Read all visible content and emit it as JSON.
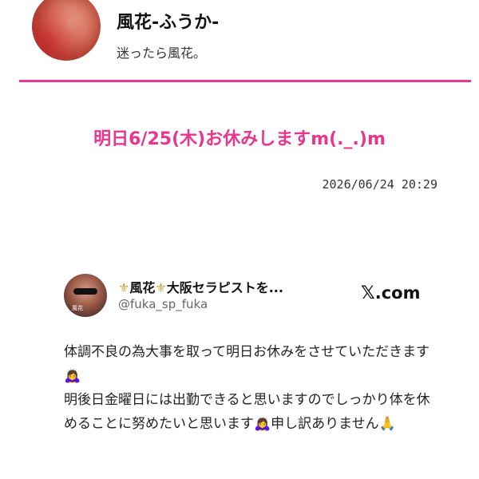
{
  "profile": {
    "name": "風花-ふうか-",
    "tagline": "迷ったら風花。"
  },
  "post": {
    "title": "明日6/25(木)お休みしますm(._.)m",
    "datetime": "2026/06/24 20:29"
  },
  "embed": {
    "fleur": "⚜",
    "display_name": "風花",
    "display_name_suffix": "大阪セラピストを...",
    "handle": "@fuka_sp_fuka",
    "avatar_tag": "風花",
    "brand_logo": "𝕏",
    "brand_text": ".com",
    "body": {
      "line1": "体調不良の為大事を取って明日お休みをさせていただきます",
      "line1_emoji": "🙇‍♀️",
      "line2": "明後日金曜日には出勤できると思いますのでしっかり体を休めることに努めたいと思います",
      "line2_emoji": "🙇‍♀️",
      "line3": "申し訳ありません",
      "line3_emoji": "🙏"
    }
  },
  "colors": {
    "accent": "#e8368f",
    "fleur": "#c8a24a"
  }
}
